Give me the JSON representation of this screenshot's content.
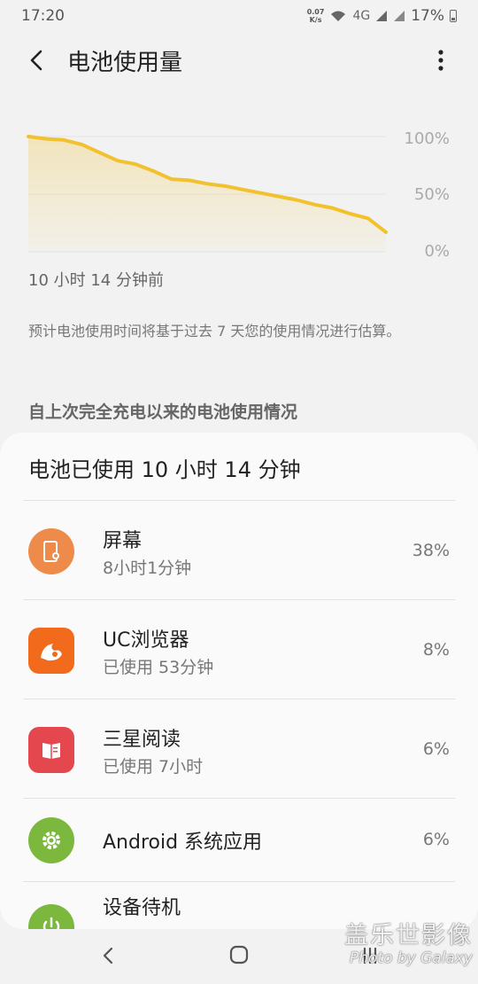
{
  "status_bar": {
    "time": "17:20",
    "net_speed_value": "0.07",
    "net_speed_unit": "K/s",
    "network_label": "4G",
    "battery_text": "17%"
  },
  "app_bar": {
    "title": "电池使用量"
  },
  "chart": {
    "y_labels": [
      "100%",
      "50%",
      "0%"
    ],
    "x_start_label": "10 小时 14 分钟前"
  },
  "chart_data": {
    "type": "area",
    "title": "",
    "xlabel": "",
    "ylabel": "",
    "ylim": [
      0,
      100
    ],
    "y_ticks": [
      "100%",
      "50%",
      "0%"
    ],
    "x_start_label": "10 小时 14 分钟前",
    "series": [
      {
        "x": [
          0,
          5,
          10,
          15,
          20,
          25,
          30,
          35,
          40,
          45,
          50,
          55,
          60,
          65,
          70,
          75,
          80,
          85,
          90,
          95,
          100
        ],
        "values": [
          100,
          98,
          97,
          93,
          86,
          79,
          76,
          70,
          63,
          62,
          59,
          57,
          54,
          51,
          48,
          45,
          41,
          38,
          33,
          29,
          17
        ],
        "color": "#f2c12e"
      }
    ]
  },
  "estimate_note": "预计电池使用时间将基于过去 7 天您的使用情况进行估算。",
  "section_header": "自上次完全充电以来的电池使用情况",
  "usage_card": {
    "title": "电池已使用 10 小时 14 分钟",
    "items": [
      {
        "name": "屏幕",
        "sub": "8小时1分钟",
        "percent": "38%",
        "icon": "screen-brightness-icon",
        "color": "#ee8a4a"
      },
      {
        "name": "UC浏览器",
        "sub": "已使用 53分钟",
        "percent": "8%",
        "icon": "uc-browser-icon",
        "color": "#f26a1c"
      },
      {
        "name": "三星阅读",
        "sub": "已使用 7小时",
        "percent": "6%",
        "icon": "samsung-reader-icon",
        "color": "#e5474e"
      },
      {
        "name": "Android 系统应用",
        "sub": "",
        "percent": "6%",
        "icon": "android-system-gear-icon",
        "color": "#7bb83d"
      },
      {
        "name": "设备待机",
        "sub": "",
        "percent": "",
        "icon": "standby-power-icon",
        "color": "#7bb83d"
      }
    ]
  },
  "watermark": {
    "title": "盖乐世影像",
    "subtitle": "Photo by Galaxy"
  },
  "colors": {
    "accent_line": "#f2c12e",
    "background": "#f2f2f2",
    "card": "#fafafa"
  }
}
